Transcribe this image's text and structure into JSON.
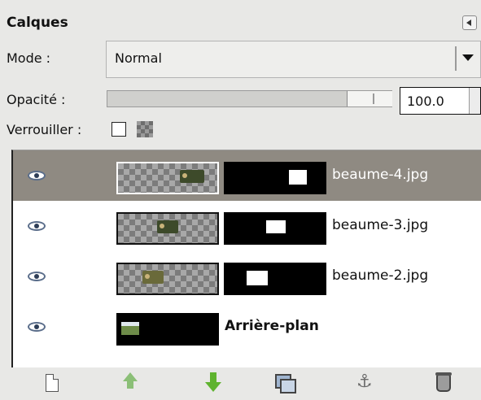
{
  "panel": {
    "title": "Calques"
  },
  "mode": {
    "label": "Mode :",
    "value": "Normal"
  },
  "opacity": {
    "label": "Opacité :",
    "value": "100.0",
    "level_percent": 100
  },
  "lock": {
    "label": "Verrouiller :"
  },
  "layers": [
    {
      "name": "beaume-4.jpg",
      "selected": true
    },
    {
      "name": "beaume-3.jpg",
      "selected": false
    },
    {
      "name": "beaume-2.jpg",
      "selected": false
    },
    {
      "name": "Arrière-plan",
      "selected": false
    }
  ],
  "toolbar": {
    "icons": [
      "new-layer-icon",
      "raise-layer-icon",
      "lower-layer-icon",
      "duplicate-layer-icon",
      "anchor-layer-icon",
      "delete-layer-icon"
    ]
  },
  "colors": {
    "selection": "#8f8a82",
    "list_bg": "#ffffff",
    "panel_bg": "#e8e8e6"
  }
}
